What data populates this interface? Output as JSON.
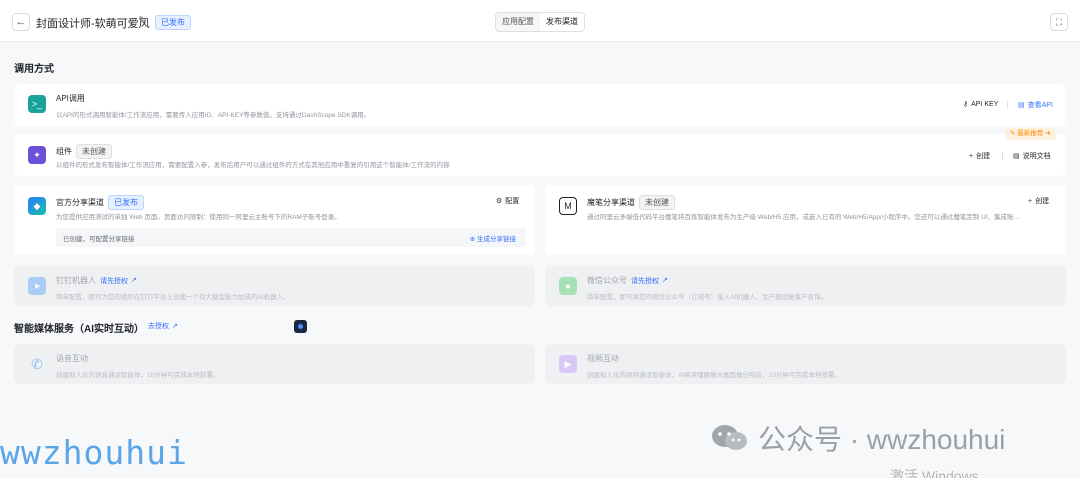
{
  "header": {
    "title": "封面设计师-软萌可爱风",
    "status": "已发布",
    "tabs": [
      {
        "label": "应用配置"
      },
      {
        "label": "发布渠道"
      }
    ]
  },
  "sections": {
    "call": "调用方式",
    "media": "智能媒体服务（AI实时互动）",
    "media_link": "去授权"
  },
  "api": {
    "title": "API调用",
    "desc": "以API的形式调用智能体/工作流应用，需要传入应用ID、API-KEY等参数值，支持通过DashScope SDK调用。",
    "key_label": "API KEY",
    "view_label": "查看API"
  },
  "component": {
    "title": "组件",
    "status": "未创建",
    "desc": "以组件的形式发布智能体/工作流应用，需要配置入参，发布后用户可以通过组件的方式在其他应用中重复的引用这个智能体/工作流的内容",
    "ribbon": "最新推荐",
    "create_label": "创建",
    "doc_label": "说明文档"
  },
  "official": {
    "title": "官方分享渠道",
    "status": "已发布",
    "desc": "为您提供应用测试的单独 Web 页面。页面访问限制：使用同一阿里云主账号下的RAM子账号登录。",
    "config_label": "配置",
    "bar_text": "已创建，可配置分享链接",
    "bar_action": "生成分享链接"
  },
  "modao": {
    "title": "魔笔分享渠道",
    "status": "未创建",
    "desc": "通过阿里云多端低代码平台魔笔将百炼智能体发布为生产级 Web/H5 应用，或嵌入已有的 Web/H5/App/小程序中。您还可以通过魔笔定制 UI、集成账…",
    "create_label": "创建"
  },
  "dingtalk": {
    "title": "钉钉机器人",
    "auth_label": "请先授权",
    "desc": "简单配置，即可为您的组织在钉钉平台上创建一个有大模型能力加成的AI机器人。"
  },
  "wechat": {
    "title": "微信公众号",
    "auth_label": "请先授权",
    "desc": "简单配置，即可将您的微信公众号（订阅号）接入AI机器人，生产模回复客户咨询。"
  },
  "voice": {
    "title": "语音互动",
    "desc": "创建拟人化的语音通话智能体，10分钟可完成本地部署。"
  },
  "video": {
    "title": "视频互动",
    "desc": "创建拟人化的视频通话智能体，AI将读懂摄像头画面做出响应，10分钟可完成本地部署。"
  },
  "watermark": {
    "left": "wwzhouhui",
    "right": "公众号 · wwzhouhui",
    "windows": "激活 Windows"
  },
  "colors": {
    "accent": "#3370ff",
    "ribbon": "#ff8800"
  }
}
